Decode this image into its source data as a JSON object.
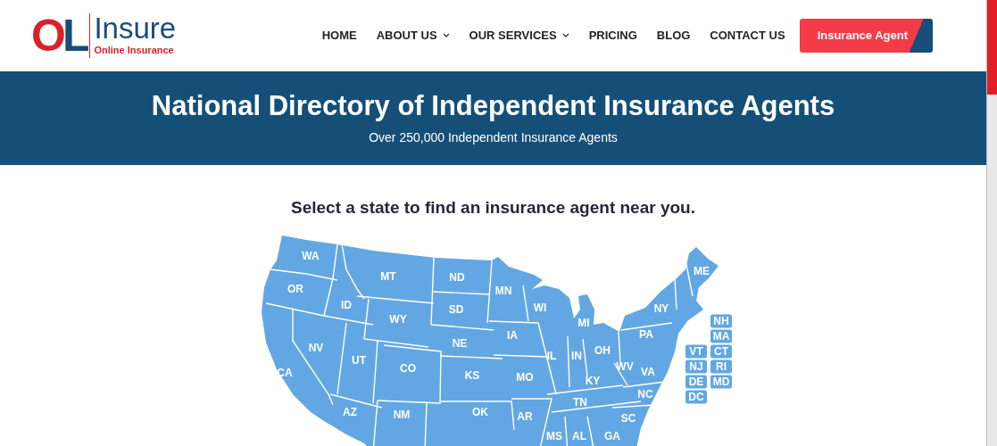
{
  "logo": {
    "mark_1": "O",
    "mark_2": "L",
    "name": "Insure",
    "tagline": "Online Insurance"
  },
  "nav": [
    {
      "label": "HOME",
      "has_dropdown": false
    },
    {
      "label": "ABOUT US",
      "has_dropdown": true
    },
    {
      "label": "OUR SERVICES",
      "has_dropdown": true
    },
    {
      "label": "PRICING",
      "has_dropdown": false
    },
    {
      "label": "BLOG",
      "has_dropdown": false
    },
    {
      "label": "CONTACT US",
      "has_dropdown": false
    }
  ],
  "cta_button": "Insurance Agent",
  "banner": {
    "title": "National Directory of Independent Insurance Agents",
    "subtitle": "Over 250,000 Independent Insurance Agents"
  },
  "prompt": "Select a state to find an insurance agent near you.",
  "states": [
    {
      "label": "WA",
      "kind": "map"
    },
    {
      "label": "MT",
      "kind": "map"
    },
    {
      "label": "ND",
      "kind": "map"
    },
    {
      "label": "ME",
      "kind": "map"
    },
    {
      "label": "OR",
      "kind": "map"
    },
    {
      "label": "MN",
      "kind": "map"
    },
    {
      "label": "ID",
      "kind": "map"
    },
    {
      "label": "SD",
      "kind": "map"
    },
    {
      "label": "WI",
      "kind": "map"
    },
    {
      "label": "NY",
      "kind": "map"
    },
    {
      "label": "WY",
      "kind": "map"
    },
    {
      "label": "MI",
      "kind": "map"
    },
    {
      "label": "IA",
      "kind": "map"
    },
    {
      "label": "PA",
      "kind": "map"
    },
    {
      "label": "NV",
      "kind": "map"
    },
    {
      "label": "NE",
      "kind": "map"
    },
    {
      "label": "OH",
      "kind": "map"
    },
    {
      "label": "UT",
      "kind": "map"
    },
    {
      "label": "IL",
      "kind": "map"
    },
    {
      "label": "IN",
      "kind": "map"
    },
    {
      "label": "CA",
      "kind": "map"
    },
    {
      "label": "CO",
      "kind": "map"
    },
    {
      "label": "KS",
      "kind": "map"
    },
    {
      "label": "MO",
      "kind": "map"
    },
    {
      "label": "KY",
      "kind": "map"
    },
    {
      "label": "WV",
      "kind": "map"
    },
    {
      "label": "VA",
      "kind": "map"
    },
    {
      "label": "NC",
      "kind": "map"
    },
    {
      "label": "TN",
      "kind": "map"
    },
    {
      "label": "AZ",
      "kind": "map"
    },
    {
      "label": "NM",
      "kind": "map"
    },
    {
      "label": "OK",
      "kind": "map"
    },
    {
      "label": "AR",
      "kind": "map"
    },
    {
      "label": "SC",
      "kind": "map"
    },
    {
      "label": "MS",
      "kind": "map"
    },
    {
      "label": "AL",
      "kind": "map"
    },
    {
      "label": "GA",
      "kind": "map"
    },
    {
      "label": "NH",
      "kind": "box"
    },
    {
      "label": "MA",
      "kind": "box"
    },
    {
      "label": "VT",
      "kind": "box"
    },
    {
      "label": "CT",
      "kind": "box"
    },
    {
      "label": "NJ",
      "kind": "box"
    },
    {
      "label": "RI",
      "kind": "box"
    },
    {
      "label": "DE",
      "kind": "box"
    },
    {
      "label": "MD",
      "kind": "box"
    },
    {
      "label": "DC",
      "kind": "box"
    }
  ]
}
